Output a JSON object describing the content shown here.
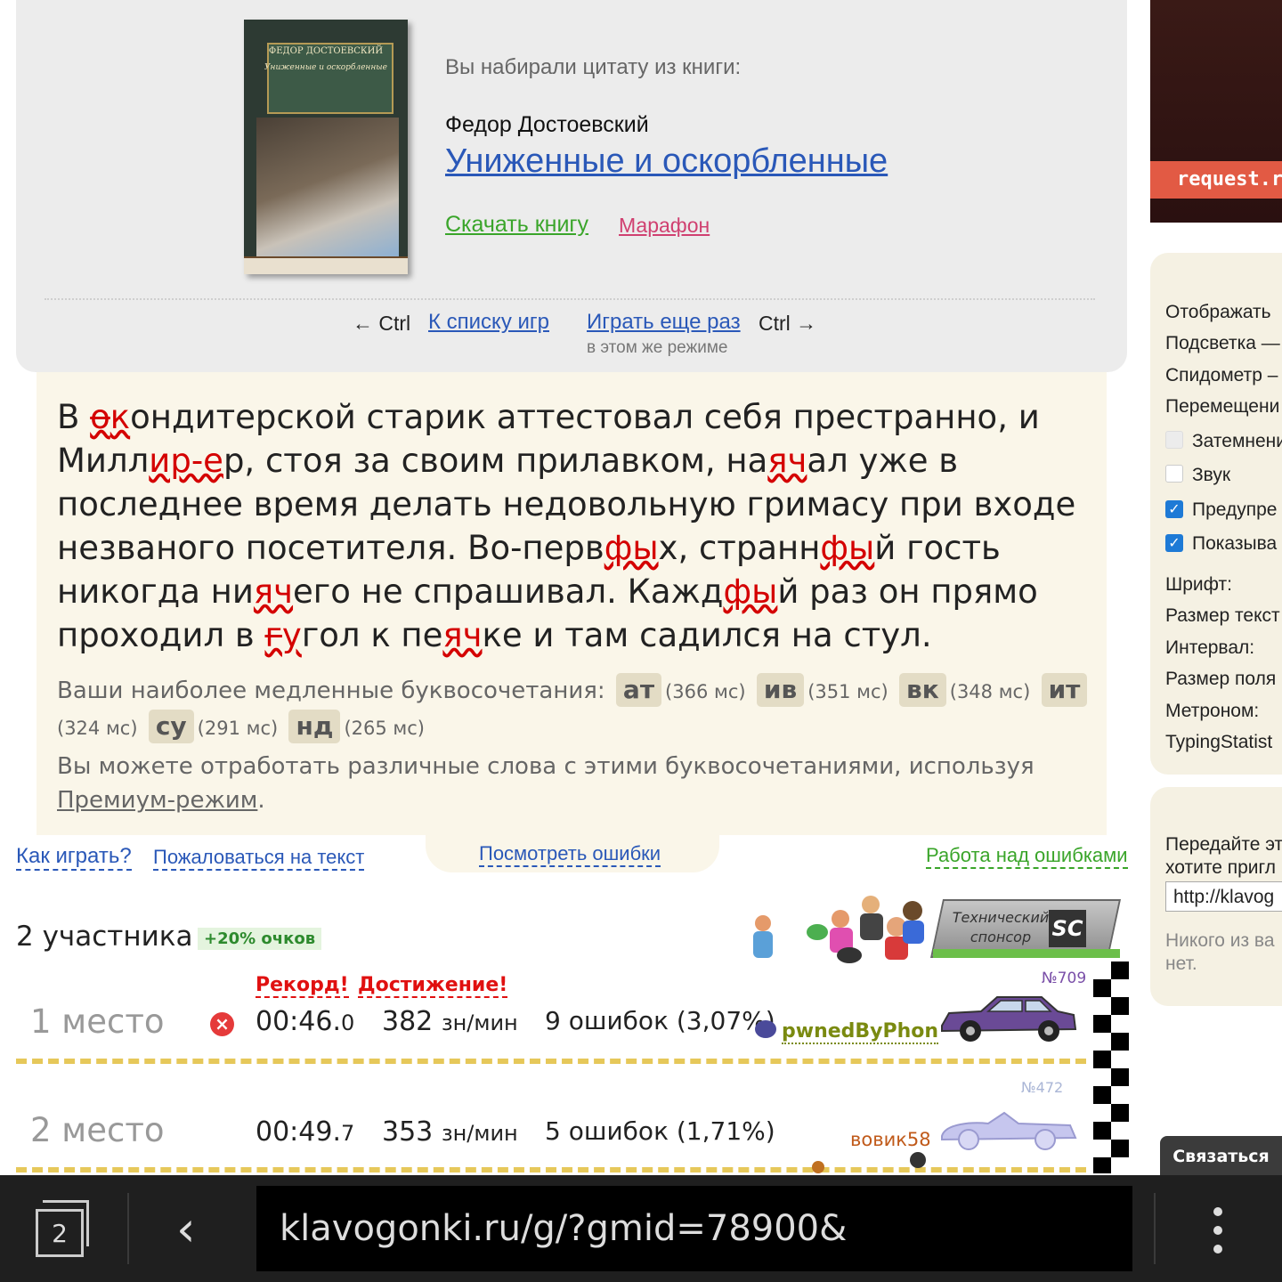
{
  "book": {
    "cover_author": "ФЕДОР ДОСТОЕВСКИЙ",
    "cover_title": "Униженные и оскорбленные",
    "quote_label": "Вы набирали цитату из книги:",
    "author": "Федор Достоевский",
    "title": "Униженные и оскорбленные",
    "download": "Скачать книгу",
    "marathon": "Марафон"
  },
  "nav": {
    "left_hint": "← Ctrl",
    "to_list": "К списку игр",
    "play_again": "Играть еще раз",
    "right_hint": "Ctrl →",
    "same_mode": "в этом же режиме"
  },
  "text_result": {
    "slow_label": "Ваши наиболее медленные буквосочетания:",
    "slow_combos": [
      {
        "combo": "ат",
        "time": "(366 мс)"
      },
      {
        "combo": "ив",
        "time": "(351 мс)"
      },
      {
        "combo": "вк",
        "time": "(348 мс)"
      },
      {
        "combo": "ит",
        "time": "(324 мс)"
      },
      {
        "combo": "су",
        "time": "(291 мс)"
      },
      {
        "combo": "нд",
        "time": "(265 мс)"
      }
    ],
    "premium_text": "Вы можете отработать различные слова с этими буквосочетаниями, используя",
    "premium_link": "Премиум-режим",
    "premium_end": "."
  },
  "links": {
    "how_to_play": "Как играть?",
    "report_text": "Пожаловаться на текст",
    "view_errors": "Посмотреть ошибки",
    "error_work": "Работа над ошибками"
  },
  "race": {
    "participants": "2 участника",
    "bonus": "+20% очков",
    "sponsor_text": "Технический спонсор",
    "sponsor_logo": "SC",
    "record": "Рекорд!",
    "achievement": "Достижение!",
    "players": [
      {
        "place": "1 место",
        "time_main": "00:46.",
        "time_frac": "0",
        "speed": "382",
        "speed_unit": "зн/мин",
        "errors": "9 ошибок (3,07%)",
        "name": "pwnedByPhon",
        "num": "№709"
      },
      {
        "place": "2 место",
        "time_main": "00:49.",
        "time_frac": "7",
        "speed": "353",
        "speed_unit": "зн/мин",
        "errors": "5 ошибок (1,71%)",
        "name": "вовик58",
        "num": "№472"
      }
    ]
  },
  "sidebar": {
    "ad_label": "request.ru",
    "settings": {
      "show": "Отображать",
      "highlight": "Подсветка —",
      "speedometer": "Спидометр –",
      "movement": "Перемещени",
      "dim": "Затемнени",
      "sound": "Звук",
      "warn": "Предупре",
      "display": "Показыва",
      "font": "Шрифт:",
      "text_size": "Размер текст",
      "interval": "Интервал:",
      "field_size": "Размер поля",
      "metronome": "Метроном:",
      "typing_stats": "TypingStatist"
    },
    "share_text_1": "Передайте эт",
    "share_text_2": "хотите пригл",
    "share_url": "http://klavog",
    "nobody_1": "Никого из ва",
    "nobody_2": "нет.",
    "contact": "Связаться"
  },
  "browser": {
    "tab_count": "2",
    "url": "klavogonki.ru/g/?gmid=78900&"
  },
  "colors": {
    "link_blue": "#2a58b8",
    "link_green": "#3aa52a",
    "error_red": "#d40000",
    "lane_yellow": "#e6c85a"
  }
}
